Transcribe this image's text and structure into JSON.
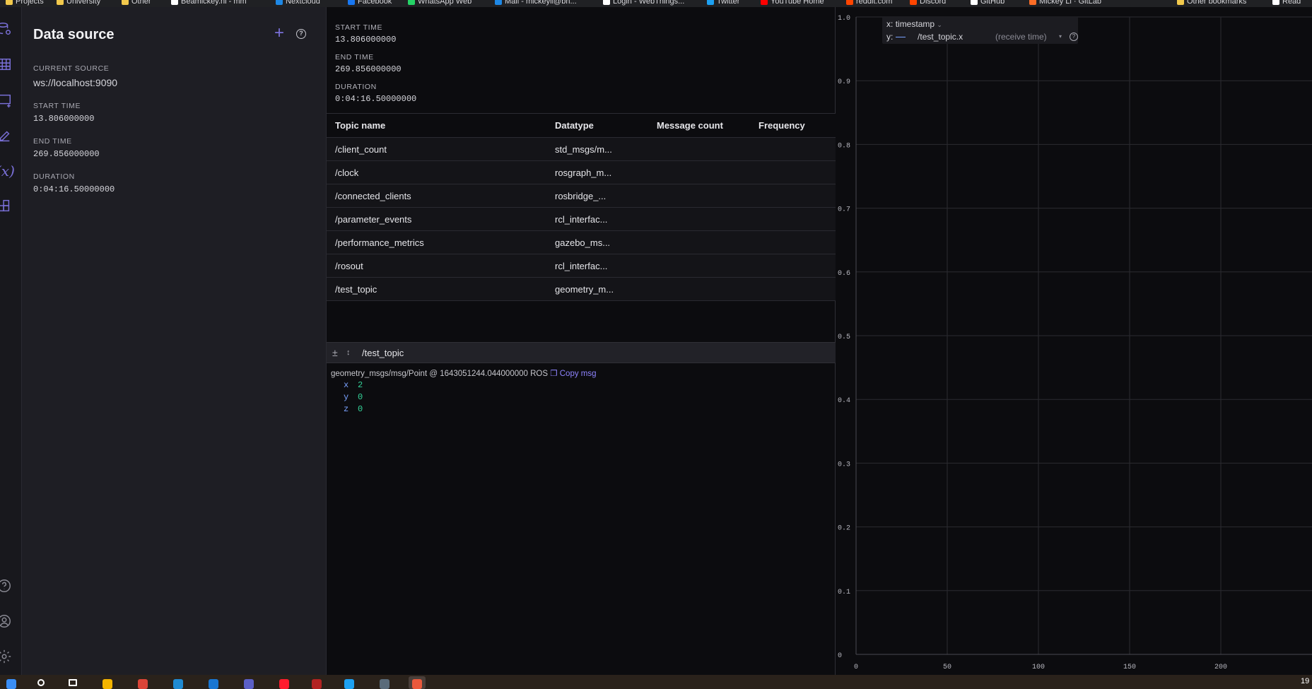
{
  "browser": {
    "bookmarks": [
      {
        "label": "Projects",
        "color": "#f2c94c",
        "icon": "folder-icon"
      },
      {
        "label": "University",
        "color": "#f2c94c",
        "icon": "folder-icon"
      },
      {
        "label": "Other",
        "color": "#f2c94c",
        "icon": "folder-icon"
      },
      {
        "label": "Beamickey.nl - mm",
        "color": "#ffffff",
        "icon": "site-icon"
      },
      {
        "label": "Nextcloud",
        "color": "#1e88e5",
        "icon": "nextcloud-icon"
      },
      {
        "label": "Facebook",
        "color": "#1877f2",
        "icon": "facebook-icon"
      },
      {
        "label": "WhatsApp Web",
        "color": "#25d366",
        "icon": "whatsapp-icon"
      },
      {
        "label": "Mail - mickeyli@bn...",
        "color": "#1e88e5",
        "icon": "mail-icon"
      },
      {
        "label": "Login - WebThings...",
        "color": "#ffffff",
        "icon": "webthings-icon"
      },
      {
        "label": "Twitter",
        "color": "#1da1f2",
        "icon": "twitter-icon"
      },
      {
        "label": "YouTube Home",
        "color": "#ff0000",
        "icon": "youtube-icon"
      },
      {
        "label": "reddit.com",
        "color": "#ff4500",
        "icon": "reddit-icon"
      },
      {
        "label": "Discord",
        "color": "#ff4500",
        "icon": "discord-icon"
      },
      {
        "label": "GitHub",
        "color": "#ffffff",
        "icon": "github-icon"
      },
      {
        "label": "Mickey Li · GitLab",
        "color": "#fc6d26",
        "icon": "gitlab-icon"
      },
      {
        "label": "Other bookmarks",
        "color": "#f2c94c",
        "icon": "folder-icon"
      },
      {
        "label": "Read",
        "color": "#ffffff",
        "icon": "reading-list-icon"
      }
    ]
  },
  "rail": {
    "icons": [
      "data-source-icon",
      "table-icon",
      "add-panel-icon",
      "edit-icon",
      "variables-icon",
      "extensions-icon",
      "help-icon",
      "account-icon",
      "settings-icon"
    ],
    "variables_glyph": "(x)"
  },
  "data_source": {
    "title": "Data source",
    "add_glyph": "+",
    "help_glyph": "?",
    "current_source_label": "CURRENT SOURCE",
    "current_source": "ws://localhost:9090",
    "start_time_label": "START TIME",
    "start_time": "13.806000000",
    "end_time_label": "END TIME",
    "end_time": "269.856000000",
    "duration_label": "DURATION",
    "duration": "0:04:16.50000000"
  },
  "topic_stats": {
    "start_time_label": "START TIME",
    "start_time": "13.806000000",
    "end_time_label": "END TIME",
    "end_time": "269.856000000",
    "duration_label": "DURATION",
    "duration": "0:04:16.50000000"
  },
  "topics_table": {
    "headers": [
      "Topic name",
      "Datatype",
      "Message count",
      "Frequency"
    ],
    "rows": [
      {
        "name": "/client_count",
        "datatype": "std_msgs/m..."
      },
      {
        "name": "/clock",
        "datatype": "rosgraph_m..."
      },
      {
        "name": "/connected_clients",
        "datatype": "rosbridge_..."
      },
      {
        "name": "/parameter_events",
        "datatype": "rcl_interfac..."
      },
      {
        "name": "/performance_metrics",
        "datatype": "gazebo_ms..."
      },
      {
        "name": "/rosout",
        "datatype": "rcl_interfac..."
      },
      {
        "name": "/test_topic",
        "datatype": "geometry_m..."
      }
    ]
  },
  "raw_message": {
    "topic": "/test_topic",
    "meta": "geometry_msgs/msg/Point @ 1643051244.044000000 ROS",
    "copy_label": "Copy msg",
    "fields": [
      {
        "key": "x",
        "value": "2"
      },
      {
        "key": "y",
        "value": "0"
      },
      {
        "key": "z",
        "value": "0"
      }
    ]
  },
  "plot": {
    "x_label": "x:",
    "x_value": "timestamp",
    "y_label": "y:",
    "series_name": "/test_topic.x",
    "series_color": "#7aa2ff",
    "timestamp_method": "(receive time)",
    "help_glyph": "?"
  },
  "chart_data": {
    "type": "line",
    "series": [
      {
        "name": "/test_topic.x",
        "x": [],
        "y": []
      }
    ],
    "xlabel": "",
    "ylabel": "",
    "xlim": [
      0,
      250
    ],
    "ylim": [
      0,
      1.0
    ],
    "x_ticks": [
      "0",
      "50",
      "100",
      "150",
      "200"
    ],
    "y_ticks": [
      "0",
      "0.1",
      "0.2",
      "0.3",
      "0.4",
      "0.5",
      "0.6",
      "0.7",
      "0.8",
      "0.9",
      "1.0"
    ],
    "grid": true,
    "legend": "top-left"
  },
  "taskbar": {
    "apps": [
      "start-icon",
      "search-icon",
      "task-view-icon",
      "file-explorer-icon",
      "chrome-icon",
      "vscode-icon",
      "edge-icon",
      "teams-icon",
      "opera-icon",
      "app-icon",
      "app-icon",
      "app-icon",
      "foxglove-icon"
    ],
    "clock_fragment": "19"
  }
}
